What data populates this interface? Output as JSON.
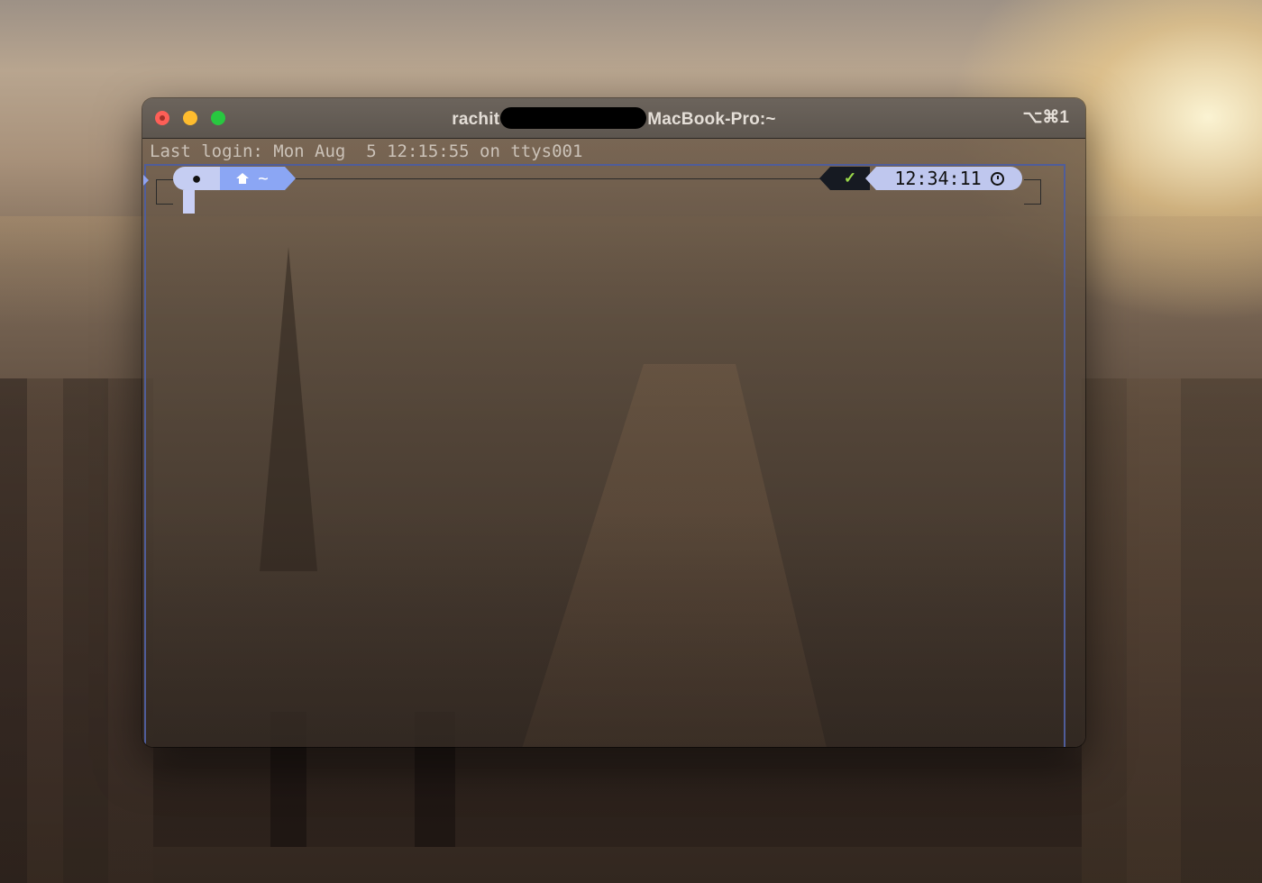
{
  "window": {
    "title_prefix": "rachit",
    "title_suffix": "MacBook-Pro:~",
    "shortcut": "⌥⌘1"
  },
  "terminal": {
    "login_line": "Last login: Mon Aug  5 12:15:55 on ttys001",
    "prompt": {
      "os_icon": "apple-icon",
      "dir_icon": "home-icon",
      "directory": "~",
      "status_symbol": "✓",
      "time": "12:34:11",
      "time_icon": "clock-icon"
    }
  },
  "colors": {
    "close": "#fe5f57",
    "minimize": "#febc2e",
    "zoom": "#28c840",
    "prompt_os_bg": "#c5cdf2",
    "prompt_dir_bg": "#8ba6f4",
    "prompt_status_bg": "#161a22",
    "prompt_ok": "#9ad84a",
    "prompt_time_bg": "#bfc7ee",
    "pane_border": "#4f5d9a"
  }
}
